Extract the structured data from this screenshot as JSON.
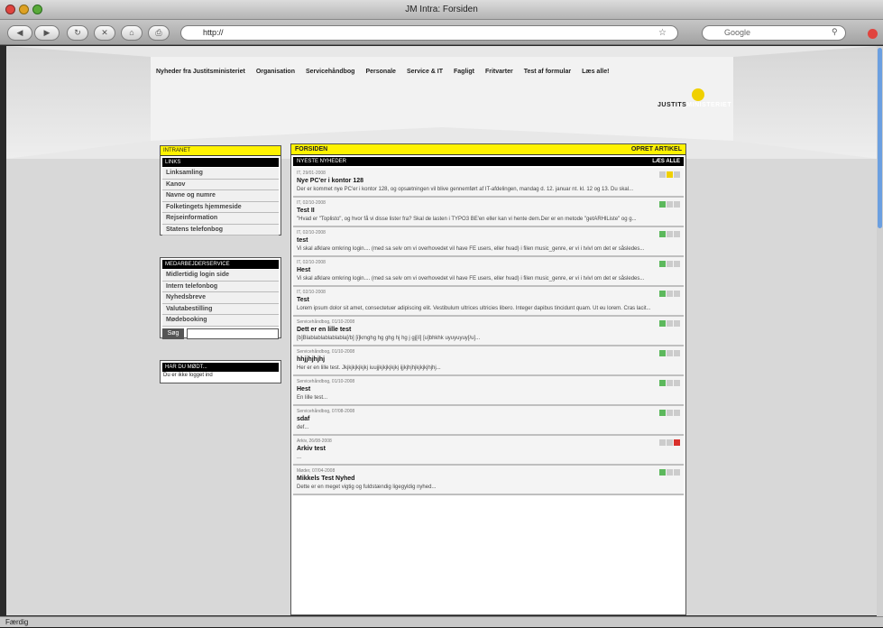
{
  "window": {
    "title": "JM Intra: Forsiden"
  },
  "toolbar": {
    "url": "http://",
    "search_placeholder": "Google"
  },
  "nav": [
    "Nyheder fra Justitsministeriet",
    "Organisation",
    "Servicehåndbog",
    "Personale",
    "Service & IT",
    "Fagligt",
    "Fritvarter",
    "Test af formular",
    "Læs alle!"
  ],
  "logo": {
    "text_a": "JUSTITS",
    "text_b": "MINISTERIET"
  },
  "intranet": {
    "header": "INTRANET",
    "sub": "LINKS",
    "items": [
      "Linksamling",
      "Kanov",
      "Navne og numre",
      "Folketingets hjemmeside",
      "Rejseinformation",
      "Statens telefonbog"
    ]
  },
  "service": {
    "header": "MEDARBEJDERSERVICE",
    "items": [
      "Midlertidig login side",
      "Intern telefonbog",
      "Nyhedsbreve",
      "Valutabestilling",
      "Mødebooking"
    ],
    "search_btn": "Søg"
  },
  "hardu": {
    "header": "HAR DU MØDT...",
    "text": "Du er ikke logget ind"
  },
  "main": {
    "title": "FORSIDEN",
    "action": "OPRET ARTIKEL",
    "sub": "NYESTE NYHEDER",
    "sub_action": "LÆS ALLE",
    "news": [
      {
        "meta": "IT, 29/01-2008",
        "title": "Nye PC'er i kontor 128",
        "body": "Der er kommet nye PC'er i kontor 128, og opsætningen vil blive gennemført af IT-afdelingen, mandag d. 12. januar nt. kl. 12 og 13. Du skal...",
        "ind": [
          "#ccc",
          "#f0d000",
          "#ccc"
        ]
      },
      {
        "meta": "IT, 02/10-2008",
        "title": "Test II",
        "body": "\"Hvad er \"Toplisto\", og hvor få vi disse lister fra? Skal de lasten i TYPO3 BE'en eller kan vi hente dem.Der er en metode \"getARHlListe\" og g...",
        "ind": [
          "#5cb85c",
          "#ccc",
          "#ccc"
        ]
      },
      {
        "meta": "IT, 02/10-2008",
        "title": "test",
        "body": "Vi skal afklare omkring login.... (med sa selv om vi overhovedet vil have FE users, eller hvad) i filen music_genre, er vi i tvivl om det er såsledes...",
        "ind": [
          "#5cb85c",
          "#ccc",
          "#ccc"
        ]
      },
      {
        "meta": "IT, 02/10-2008",
        "title": "Hest",
        "body": "Vi skal afklare omkring login.... (med sa selv om vi overhovedet vil have FE users, eller hvad) i filen music_genre, er vi i tvivl om det er såsledes...",
        "ind": [
          "#5cb85c",
          "#ccc",
          "#ccc"
        ]
      },
      {
        "meta": "IT, 02/10-2008",
        "title": "Test",
        "body": "Lorem ipsum dolor sit amet, consectetuer adipiscing elit. Vestibulum ultrices ultricies libero. Integer dapibus tincidunt quam. Ut eu lorem. Cras lacit...",
        "ind": [
          "#5cb85c",
          "#ccc",
          "#ccc"
        ]
      },
      {
        "meta": "Servicehåndbog, 01/10-2008",
        "title": "Dett er en lille test",
        "body": "[b]Blablablablablabla[/b] [i]kmghg hg ghg hj hg j gj[/i] [u]bhkhk uyuyuyuy[/u]...",
        "ind": [
          "#5cb85c",
          "#ccc",
          "#ccc"
        ]
      },
      {
        "meta": "Servicehåndbog, 01/10-2008",
        "title": "hhjjhjhjhj",
        "body": "Her er en lille test. Jkjkjkjkjkjkj iuujjkjkjkjkjkj ijjkjhjhjkjkjkjhjhj...",
        "ind": [
          "#5cb85c",
          "#ccc",
          "#ccc"
        ]
      },
      {
        "meta": "Servicehåndbog, 01/10-2008",
        "title": "Hest",
        "body": "En lille test...",
        "ind": [
          "#5cb85c",
          "#ccc",
          "#ccc"
        ]
      },
      {
        "meta": "Servicehåndbog, 07/08-2008",
        "title": "sdaf",
        "body": "def...",
        "ind": [
          "#5cb85c",
          "#ccc",
          "#ccc"
        ]
      },
      {
        "meta": "Arkiv, 26/08-2008",
        "title": "Arkiv test",
        "body": "...",
        "ind": [
          "#ccc",
          "#ccc",
          "#d9302b"
        ]
      },
      {
        "meta": "Møder, 07/04-2008",
        "title": "Mikkels Test Nyhed",
        "body": "Dette er en meget vigtig og fuldstændig ligegyldig nyhed...",
        "ind": [
          "#5cb85c",
          "#ccc",
          "#ccc"
        ]
      }
    ]
  },
  "status": {
    "text": "Færdig"
  }
}
